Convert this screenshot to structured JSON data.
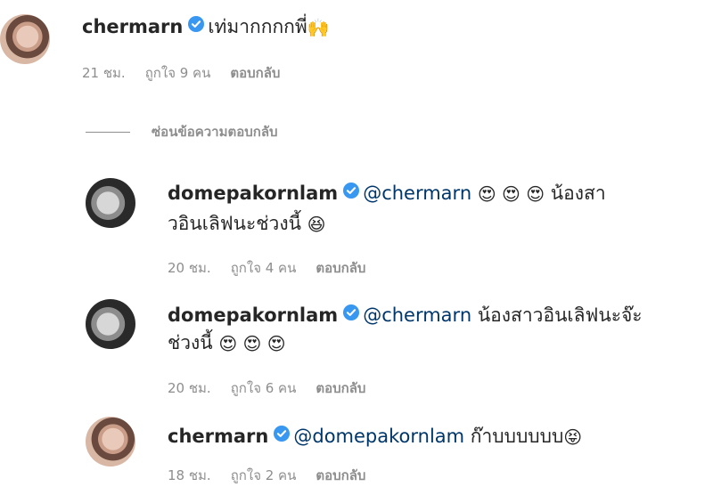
{
  "comments": [
    {
      "username": "chermarn",
      "mention": "",
      "text": "เท่มากกกกพี่",
      "emoji": "🙌",
      "time": "21 ชม.",
      "likes": "ถูกใจ 9 คน",
      "reply": "ตอบกลับ",
      "avatar": "woman-avatar"
    },
    {
      "username": "domepakornlam",
      "mention": "@chermarn",
      "emoji_before": "😍 😍 😍",
      "text_line1": "น้องสา",
      "text_line2": "วอินเลิฟนะช่วงนี้",
      "emoji_after": "😆",
      "time": "20 ชม.",
      "likes": "ถูกใจ 4 คน",
      "reply": "ตอบกลับ",
      "avatar": "man-avatar"
    },
    {
      "username": "domepakornlam",
      "mention": "@chermarn",
      "text_line1": "น้องสาวอินเลิฟนะจ๊ะ",
      "text_line2": "ช่วงนี้",
      "emoji_after": "😍 😍 😍",
      "time": "20 ชม.",
      "likes": "ถูกใจ 6 คน",
      "reply": "ตอบกลับ",
      "avatar": "man-avatar"
    },
    {
      "username": "chermarn",
      "mention": "@domepakornlam",
      "text": "ก๊าบบบบบบ",
      "emoji": "😝",
      "time": "18 ชม.",
      "likes": "ถูกใจ 2 คน",
      "reply": "ตอบกลับ",
      "avatar": "woman-avatar"
    }
  ],
  "hide_replies": "ซ่อนข้อความตอบกลับ",
  "colors": {
    "text": "#262626",
    "meta": "#8e8e8e",
    "mention": "#00376b",
    "verified": "#3897f0"
  }
}
